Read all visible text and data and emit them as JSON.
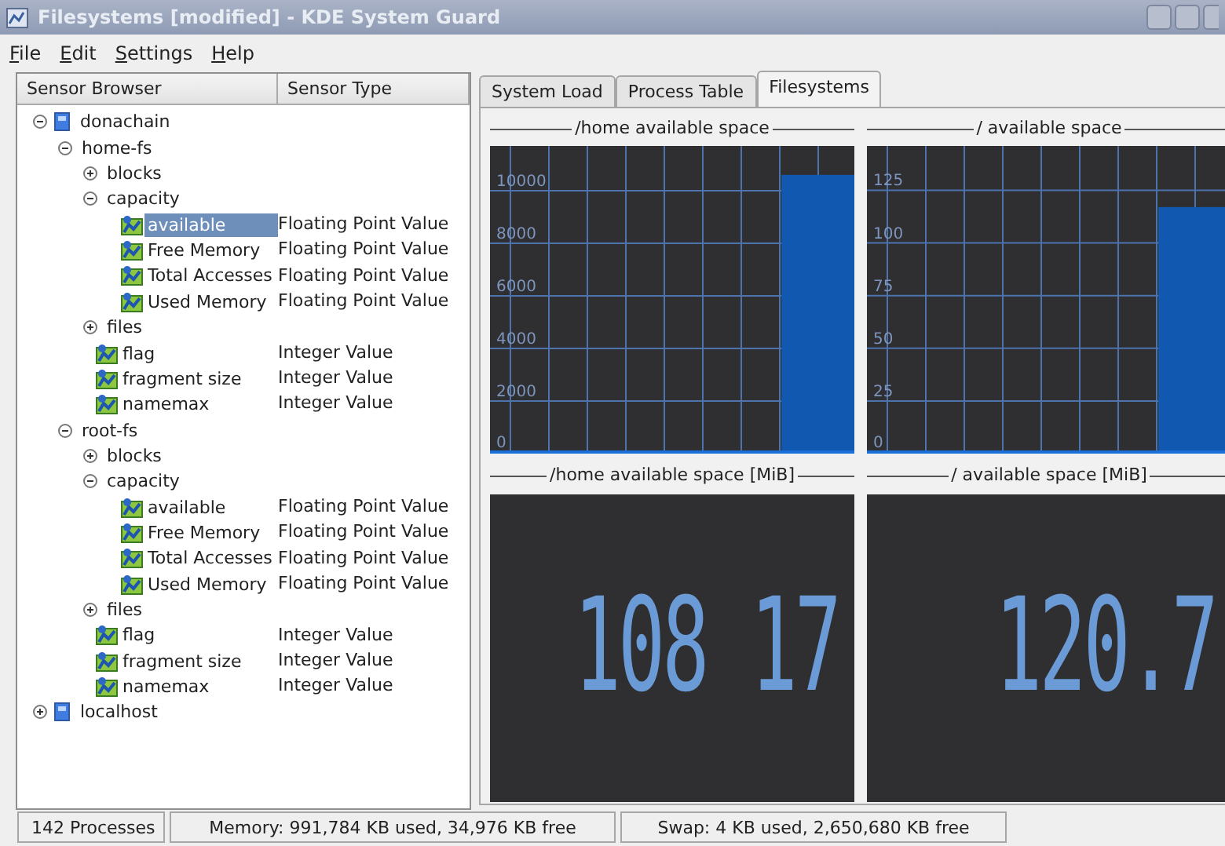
{
  "window": {
    "title": "Filesystems [modified] - KDE System Guard"
  },
  "menu": [
    "File",
    "Edit",
    "Settings",
    "Help"
  ],
  "sensor_browser": {
    "columns": [
      "Sensor Browser",
      "Sensor Type"
    ],
    "tree": [
      {
        "label": "donachain",
        "kind": "host",
        "expanded": true,
        "selected": false,
        "children": [
          {
            "label": "home-fs",
            "expanded": true,
            "selected": false,
            "children": [
              {
                "label": "blocks",
                "expanded": false,
                "selected": false
              },
              {
                "label": "capacity",
                "expanded": true,
                "selected": false,
                "children": [
                  {
                    "label": "available",
                    "kind": "sensor",
                    "type": "Floating Point Value",
                    "selected": true
                  },
                  {
                    "label": "Free Memory",
                    "kind": "sensor",
                    "type": "Floating Point Value",
                    "selected": false
                  },
                  {
                    "label": "Total Accesses",
                    "kind": "sensor",
                    "type": "Floating Point Value",
                    "selected": false
                  },
                  {
                    "label": "Used Memory",
                    "kind": "sensor",
                    "type": "Floating Point Value",
                    "selected": false
                  }
                ]
              },
              {
                "label": "files",
                "expanded": false,
                "selected": false
              },
              {
                "label": "flag",
                "kind": "sensor",
                "type": "Integer Value",
                "selected": false
              },
              {
                "label": "fragment size",
                "kind": "sensor",
                "type": "Integer Value",
                "selected": false
              },
              {
                "label": "namemax",
                "kind": "sensor",
                "type": "Integer Value",
                "selected": false
              }
            ]
          },
          {
            "label": "root-fs",
            "expanded": true,
            "selected": false,
            "children": [
              {
                "label": "blocks",
                "expanded": false,
                "selected": false
              },
              {
                "label": "capacity",
                "expanded": true,
                "selected": false,
                "children": [
                  {
                    "label": "available",
                    "kind": "sensor",
                    "type": "Floating Point Value",
                    "selected": false
                  },
                  {
                    "label": "Free Memory",
                    "kind": "sensor",
                    "type": "Floating Point Value",
                    "selected": false
                  },
                  {
                    "label": "Total Accesses",
                    "kind": "sensor",
                    "type": "Floating Point Value",
                    "selected": false
                  },
                  {
                    "label": "Used Memory",
                    "kind": "sensor",
                    "type": "Floating Point Value",
                    "selected": false
                  }
                ]
              },
              {
                "label": "files",
                "expanded": false,
                "selected": false
              },
              {
                "label": "flag",
                "kind": "sensor",
                "type": "Integer Value",
                "selected": false
              },
              {
                "label": "fragment size",
                "kind": "sensor",
                "type": "Integer Value",
                "selected": false
              },
              {
                "label": "namemax",
                "kind": "sensor",
                "type": "Integer Value",
                "selected": false
              }
            ]
          }
        ]
      },
      {
        "label": "localhost",
        "kind": "host",
        "expanded": false,
        "selected": false
      }
    ]
  },
  "tabs": [
    {
      "label": "System Load",
      "selected": false
    },
    {
      "label": "Process Table",
      "selected": false
    },
    {
      "label": "Filesystems",
      "selected": true
    }
  ],
  "charts": [
    {
      "title": "/home available space",
      "chart_data": {
        "type": "bar",
        "values": [
          0,
          0,
          0,
          0,
          10600
        ],
        "ylim": [
          0,
          11700
        ],
        "yticks": [
          0,
          2000,
          4000,
          6000,
          8000,
          10000
        ],
        "grid": true
      }
    },
    {
      "title": "/ available space",
      "chart_data": {
        "type": "bar",
        "values": [
          0,
          0,
          0,
          0,
          117
        ],
        "ylim": [
          0,
          146
        ],
        "yticks": [
          0,
          25,
          50,
          75,
          100,
          125
        ],
        "grid": true
      }
    }
  ],
  "displays": [
    {
      "title": "/home available space [MiB]",
      "value": "108 17"
    },
    {
      "title": "/ available space [MiB]",
      "value": "120.7"
    }
  ],
  "status_bar": [
    "142 Processes",
    "Memory: 991,784 KB used, 34,976 KB free",
    "Swap: 4 KB used, 2,650,680 KB free"
  ]
}
